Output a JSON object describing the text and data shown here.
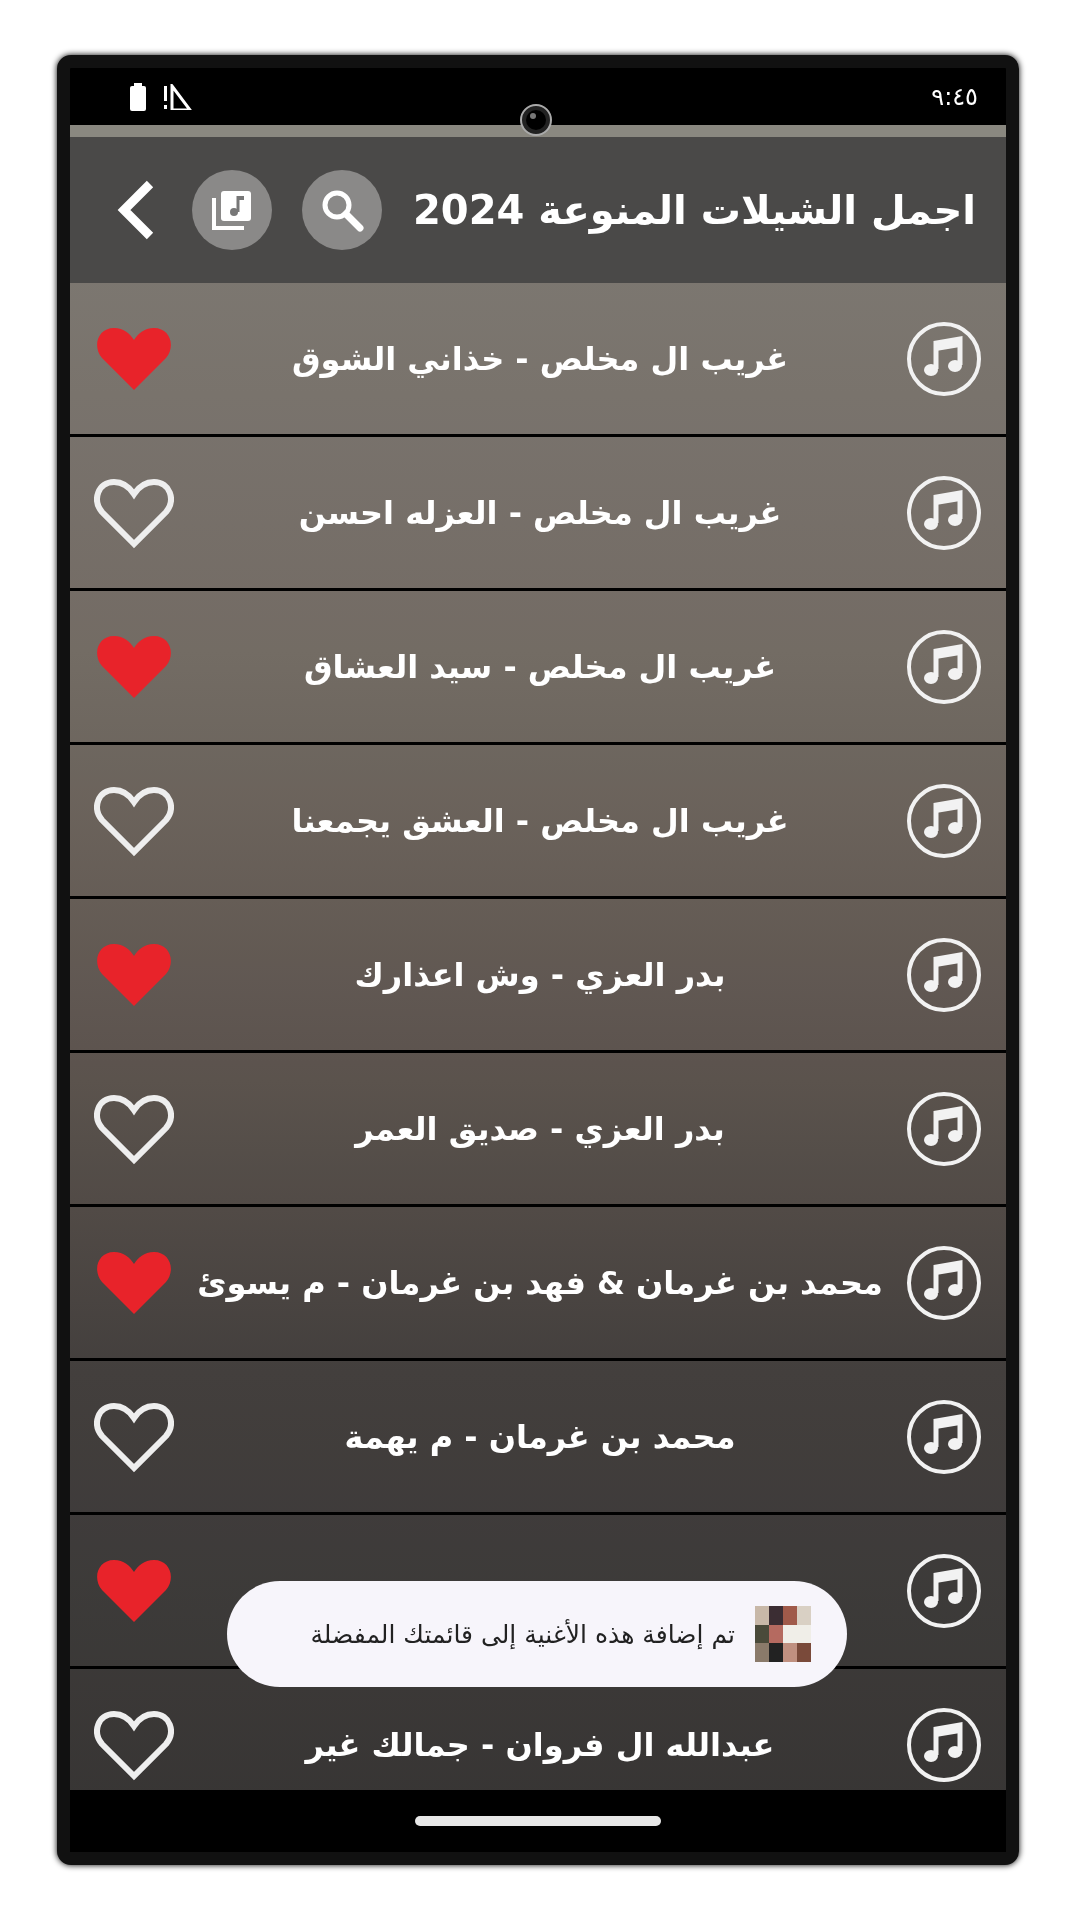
{
  "status_bar": {
    "time": "٩:٤٥"
  },
  "header": {
    "title": "اجمل الشيلات المنوعة 2024"
  },
  "songs": [
    {
      "title": "غريب ال مخلص - خذاني الشوق",
      "favorite": true
    },
    {
      "title": "غريب ال مخلص - العزله احسن",
      "favorite": false
    },
    {
      "title": "غريب ال مخلص - سيد العشاق",
      "favorite": true
    },
    {
      "title": "غريب ال مخلص - العشق يجمعنا",
      "favorite": false
    },
    {
      "title": "بدر العزي - وش اعذارك",
      "favorite": true
    },
    {
      "title": "بدر العزي - صديق العمر",
      "favorite": false
    },
    {
      "title": "محمد بن غرمان & فهد بن غرمان - م يسوئ",
      "favorite": true
    },
    {
      "title": "محمد بن غرمان - م يهمة",
      "favorite": false
    },
    {
      "favorite": true
    },
    {
      "title": "عبدالله ال فروان - جمالك غير",
      "favorite": false
    }
  ],
  "toast": {
    "message": "تم إضافة هذه الأغنية إلى قائمتك المفضلة"
  }
}
